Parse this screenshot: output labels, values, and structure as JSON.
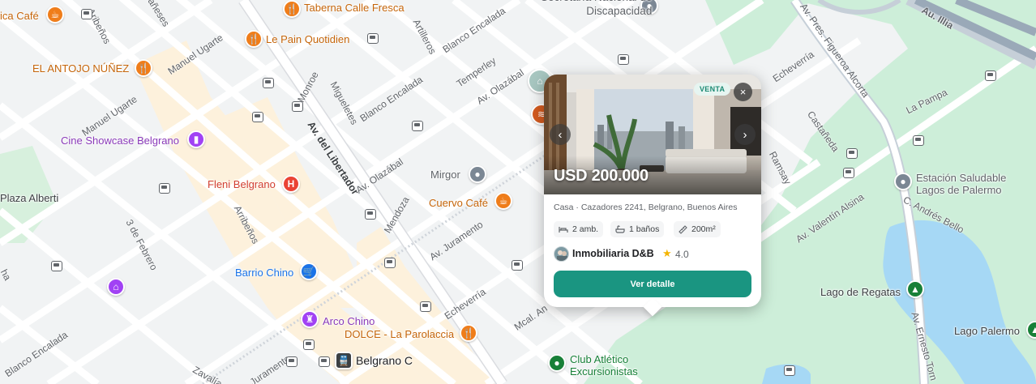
{
  "map": {
    "pois": {
      "taberna": "Taberna Calle Fresca",
      "cafe_left": "ica Café",
      "pain": "Le Pain Quotidien",
      "antojo": "EL ANTOJO NÚÑEZ",
      "cine": "Cine Showcase Belgrano",
      "fleni": "Fleni Belgrano",
      "plaza": "Plaza Alberti",
      "barrio_chino": "Barrio Chino",
      "arco_chino": "Arco Chino",
      "dolce": "DOLCE - La Parolaccia",
      "belgrano_c": "Belgrano C",
      "mirgor": "Mirgor",
      "cuervo": "Cuervo Café",
      "club": "Club Atlético\nExcursionistas",
      "discapacidad": "Secretaría Nacional de\nDiscapacidad",
      "estacion": "Estación Saludable\nLagos de Palermo",
      "lago_regatas": "Lago de Regatas",
      "lago_palermo": "Lago Palermo"
    },
    "streets": {
      "aribenos_top": "Aribeños",
      "aribenos_bottom": "Arribeños",
      "manuel_ugarte_1": "Manuel Ugarte",
      "manuel_ugarte_2": "Manuel Ugarte",
      "monroe": "Monroe",
      "migueletes": "Migueletes",
      "artilleros": "Artilleros",
      "blanco_encalada_1": "Blanco Encalada",
      "blanco_encalada_2": "Blanco Encalada",
      "blanco_encalada_3": "Blanco Encalada",
      "temperley": "Temperley",
      "olazabal_1": "Av. Olazábal",
      "olazabal_2": "Av. Olazábal",
      "libertador": "Av. del Libertador",
      "mendoza": "Mendoza",
      "juramento_1": "Av. Juramento",
      "juramento_2": "Juramento",
      "echeverria_1": "Echeverría",
      "echeverria_2": "Echeverría",
      "tres_febrero": "3 de Febrero",
      "manes": "añeses",
      "mcal": "Mcal. An",
      "zavalia": "Zavalía",
      "figueroa": "Av. Pres. Figueroa Alcorta",
      "la_pampa": "La Pampa",
      "castaneda": "Castañeda",
      "ramsay": "Ramsay",
      "alsina": "Av. Valentín Alsina",
      "andres_bello": "C. Andrés Bello",
      "illia": "Au. Illia",
      "ernesto": "Av. Ernesto Torn",
      "echeverria_3": "Echeverría",
      "pa": "ha"
    }
  },
  "listing": {
    "badge": "VENTA",
    "close_glyph": "×",
    "prev_glyph": "‹",
    "next_glyph": "›",
    "price": "USD 200.000",
    "address": "Casa · Cazadores 2241, Belgrano, Buenos Aires",
    "features": {
      "rooms": "2 amb.",
      "baths": "1 baños",
      "area": "200m²"
    },
    "agency": "Inmobiliaria D&B",
    "rating": "4.0",
    "cta": "Ver detalle"
  },
  "colors": {
    "accent": "#1a9581",
    "park": "#cdeed9",
    "water": "#a6d8f5",
    "block": "#fdf1dc"
  }
}
